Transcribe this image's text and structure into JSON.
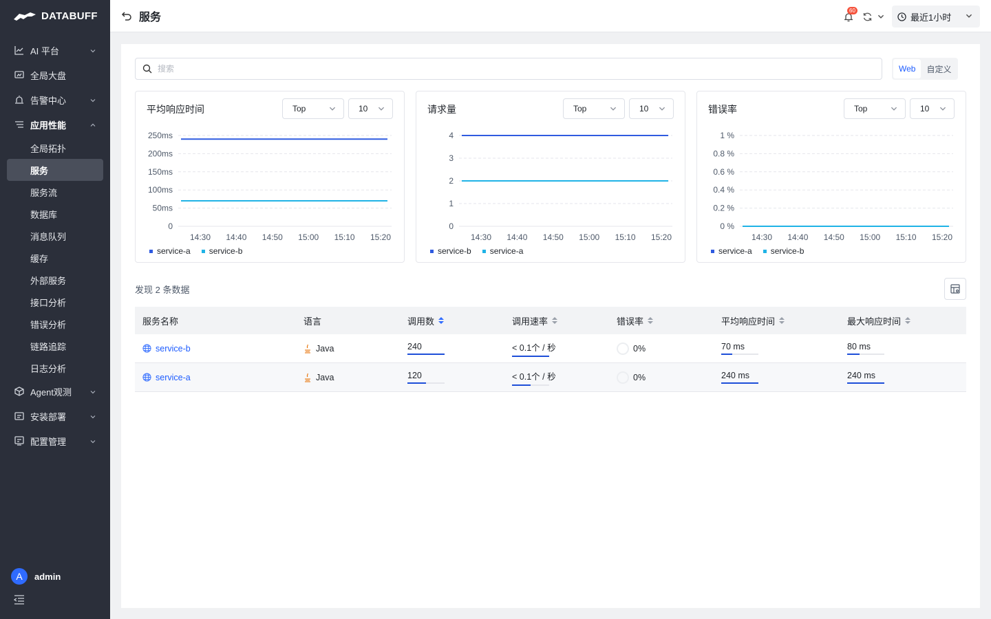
{
  "brand": "DATABUFF",
  "sidebar": {
    "items": [
      {
        "label": "AI 平台"
      },
      {
        "label": "全局大盘"
      },
      {
        "label": "告警中心"
      },
      {
        "label": "应用性能"
      },
      {
        "label": "Agent观测"
      },
      {
        "label": "安装部署"
      },
      {
        "label": "配置管理"
      }
    ],
    "sub_items": [
      "全局拓扑",
      "服务",
      "服务流",
      "数据库",
      "消息队列",
      "缓存",
      "外部服务",
      "接口分析",
      "错误分析",
      "链路追踪",
      "日志分析"
    ],
    "user": {
      "initial": "A",
      "name": "admin"
    }
  },
  "header": {
    "title": "服务",
    "notification_count": "60",
    "time_range": "最近1小时"
  },
  "search": {
    "placeholder": "搜索"
  },
  "view_toggle": {
    "web": "Web",
    "custom": "自定义"
  },
  "charts": [
    {
      "title": "平均响应时间",
      "top_label": "Top",
      "top_n": "10"
    },
    {
      "title": "请求量",
      "top_label": "Top",
      "top_n": "10"
    },
    {
      "title": "错误率",
      "top_label": "Top",
      "top_n": "10"
    }
  ],
  "chart_data": [
    {
      "type": "line",
      "title": "平均响应时间",
      "x": [
        "14:30",
        "14:40",
        "14:50",
        "15:00",
        "15:10",
        "15:20"
      ],
      "y_ticks": [
        "0",
        "50ms",
        "100ms",
        "150ms",
        "200ms",
        "250ms"
      ],
      "ylim": [
        0,
        250
      ],
      "series": [
        {
          "name": "service-a",
          "color": "#2f5be0",
          "values": [
            240,
            240,
            240,
            240,
            240,
            240
          ]
        },
        {
          "name": "service-b",
          "color": "#1fb3e6",
          "values": [
            70,
            70,
            70,
            70,
            70,
            70
          ]
        }
      ]
    },
    {
      "type": "line",
      "title": "请求量",
      "x": [
        "14:30",
        "14:40",
        "14:50",
        "15:00",
        "15:10",
        "15:20"
      ],
      "y_ticks": [
        "0",
        "1",
        "2",
        "3",
        "4"
      ],
      "ylim": [
        0,
        4
      ],
      "series": [
        {
          "name": "service-b",
          "color": "#2f5be0",
          "values": [
            4,
            4,
            4,
            4,
            4,
            4
          ]
        },
        {
          "name": "service-a",
          "color": "#1fb3e6",
          "values": [
            2,
            2,
            2,
            2,
            2,
            2
          ]
        }
      ]
    },
    {
      "type": "line",
      "title": "错误率",
      "x": [
        "14:30",
        "14:40",
        "14:50",
        "15:00",
        "15:10",
        "15:20"
      ],
      "y_ticks": [
        "0 %",
        "0.2 %",
        "0.4 %",
        "0.6 %",
        "0.8 %",
        "1 %"
      ],
      "ylim": [
        0,
        1
      ],
      "series": [
        {
          "name": "service-a",
          "color": "#2f5be0",
          "values": [
            0,
            0,
            0,
            0,
            0,
            0
          ]
        },
        {
          "name": "service-b",
          "color": "#1fb3e6",
          "values": [
            0,
            0,
            0,
            0,
            0,
            0
          ]
        }
      ]
    }
  ],
  "table": {
    "found_text": "发现 2 条数据",
    "columns": [
      "服务名称",
      "语言",
      "调用数",
      "调用速率",
      "错误率",
      "平均响应时间",
      "最大响应时间"
    ],
    "rows": [
      {
        "name": "service-b",
        "lang": "Java",
        "calls": "240",
        "calls_frac": 1.0,
        "rate": "< 0.1个 / 秒",
        "rate_frac": 1.0,
        "error": "0%",
        "avg": "70 ms",
        "avg_frac": 0.29,
        "max": "80 ms",
        "max_frac": 0.33
      },
      {
        "name": "service-a",
        "lang": "Java",
        "calls": "120",
        "calls_frac": 0.5,
        "rate": "< 0.1个 / 秒",
        "rate_frac": 0.5,
        "error": "0%",
        "avg": "240 ms",
        "avg_frac": 1.0,
        "max": "240 ms",
        "max_frac": 1.0
      }
    ]
  }
}
